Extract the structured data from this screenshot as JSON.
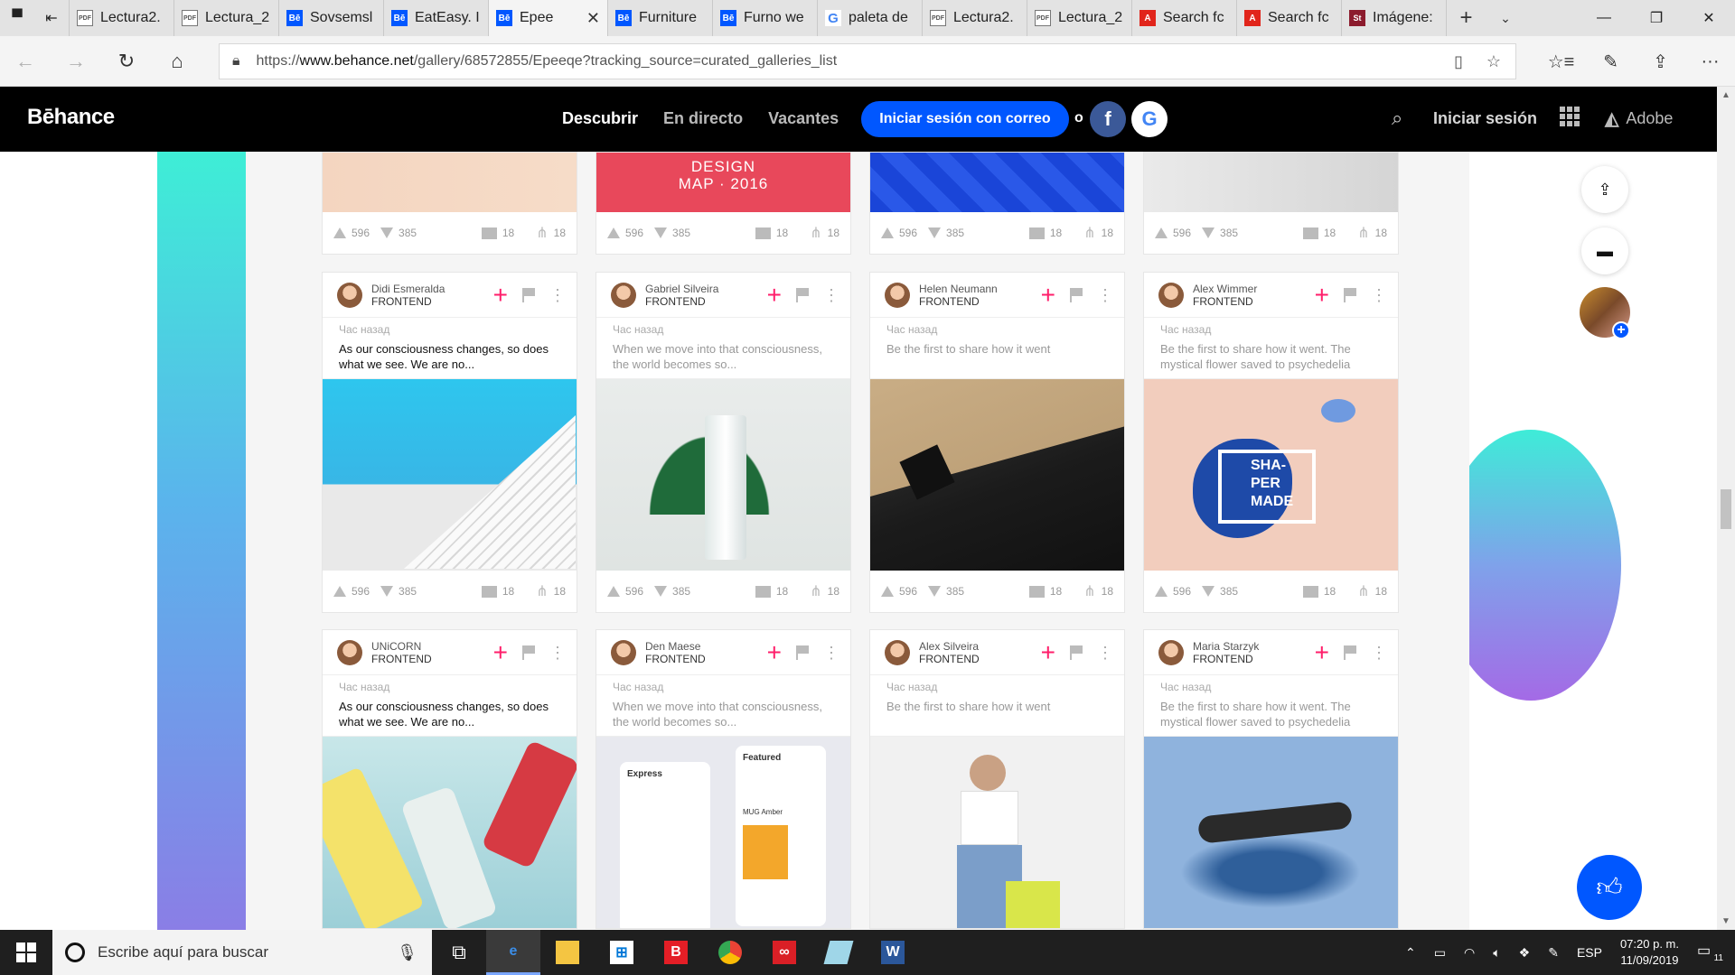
{
  "browser": {
    "tabs": [
      {
        "label": "Lectura2.",
        "icon": "pdf"
      },
      {
        "label": "Lectura_2",
        "icon": "pdf"
      },
      {
        "label": "Sovsemsl",
        "icon": "behance"
      },
      {
        "label": "EatEasy. I",
        "icon": "behance"
      },
      {
        "label": "Epee",
        "icon": "behance",
        "active": true
      },
      {
        "label": "Furniture",
        "icon": "behance"
      },
      {
        "label": "Furno we",
        "icon": "behance"
      },
      {
        "label": "paleta de",
        "icon": "google"
      },
      {
        "label": "Lectura2.",
        "icon": "pdf"
      },
      {
        "label": "Lectura_2",
        "icon": "pdf"
      },
      {
        "label": "Search fc",
        "icon": "adobe"
      },
      {
        "label": "Search fc",
        "icon": "adobe"
      },
      {
        "label": "Imágene:",
        "icon": "stock"
      }
    ],
    "url_prefix": "https://",
    "url_host": "www.behance.net",
    "url_path": "/gallery/68572855/Epeeqe?tracking_source=curated_galleries_list"
  },
  "header": {
    "logo": "Bēhance",
    "nav": [
      "Descubrir",
      "En directo",
      "Vacantes"
    ],
    "login_button": "Iniciar sesión con correo",
    "or": "o",
    "facebook": "f",
    "google": "G",
    "signin": "Iniciar sesión",
    "adobe": "Adobe"
  },
  "top_row_stats": {
    "appreciations": "596",
    "views": "385",
    "comments": "18",
    "shares": "18"
  },
  "top_row_art": [
    "",
    "DESIGN\nMAP · 2016",
    "",
    ""
  ],
  "cards": [
    {
      "name": "Didi Esmeralda",
      "role": "FRONTEND",
      "time": "Час назад",
      "text": "As our consciousness changes, so does what we see. We are  no...",
      "dark": true,
      "appreciations": "596",
      "views": "385",
      "comments": "18",
      "shares": "18"
    },
    {
      "name": "Gabriel Silveira",
      "role": "FRONTEND",
      "time": "Час назад",
      "text": "When we move into that consciousness, the world becomes  so...",
      "dark": false,
      "appreciations": "596",
      "views": "385",
      "comments": "18",
      "shares": "18"
    },
    {
      "name": "Helen Neumann",
      "role": "FRONTEND",
      "time": "Час назад",
      "text": "Be the first to share how it went",
      "dark": false,
      "appreciations": "596",
      "views": "385",
      "comments": "18",
      "shares": "18"
    },
    {
      "name": "Alex Wimmer",
      "role": "FRONTEND",
      "time": "Час назад",
      "text": "Be the first to share how it went. The mystical flower  saved to psychedelia",
      "dark": false,
      "appreciations": "596",
      "views": "385",
      "comments": "18",
      "shares": "18"
    },
    {
      "name": "UNiCORN",
      "role": "FRONTEND",
      "time": "Час назад",
      "text": "As our consciousness changes, so does what we see. We are  no...",
      "dark": true
    },
    {
      "name": "Den Maese",
      "role": "FRONTEND",
      "time": "Час назад",
      "text": "When we move into that consciousness, the world becomes  so...",
      "dark": false
    },
    {
      "name": "Alex Silveira",
      "role": "FRONTEND",
      "time": "Час назад",
      "text": "Be the first to share how it went",
      "dark": false
    },
    {
      "name": "Maria Starzyk",
      "role": "FRONTEND",
      "time": "Час назад",
      "text": "Be the first to share how it went. The mystical flower  saved to psychedelia",
      "dark": false
    }
  ],
  "art": {
    "shaper_logo": "SHA-\nPER\nMADE",
    "express_title": "Express",
    "featured_title": "Featured",
    "mug_label": "MUG Amber"
  },
  "taskbar": {
    "search_placeholder": "Escribe aquí para buscar",
    "language": "ESP",
    "time": "07:20 p. m.",
    "date": "11/09/2019",
    "notifications": "11"
  }
}
